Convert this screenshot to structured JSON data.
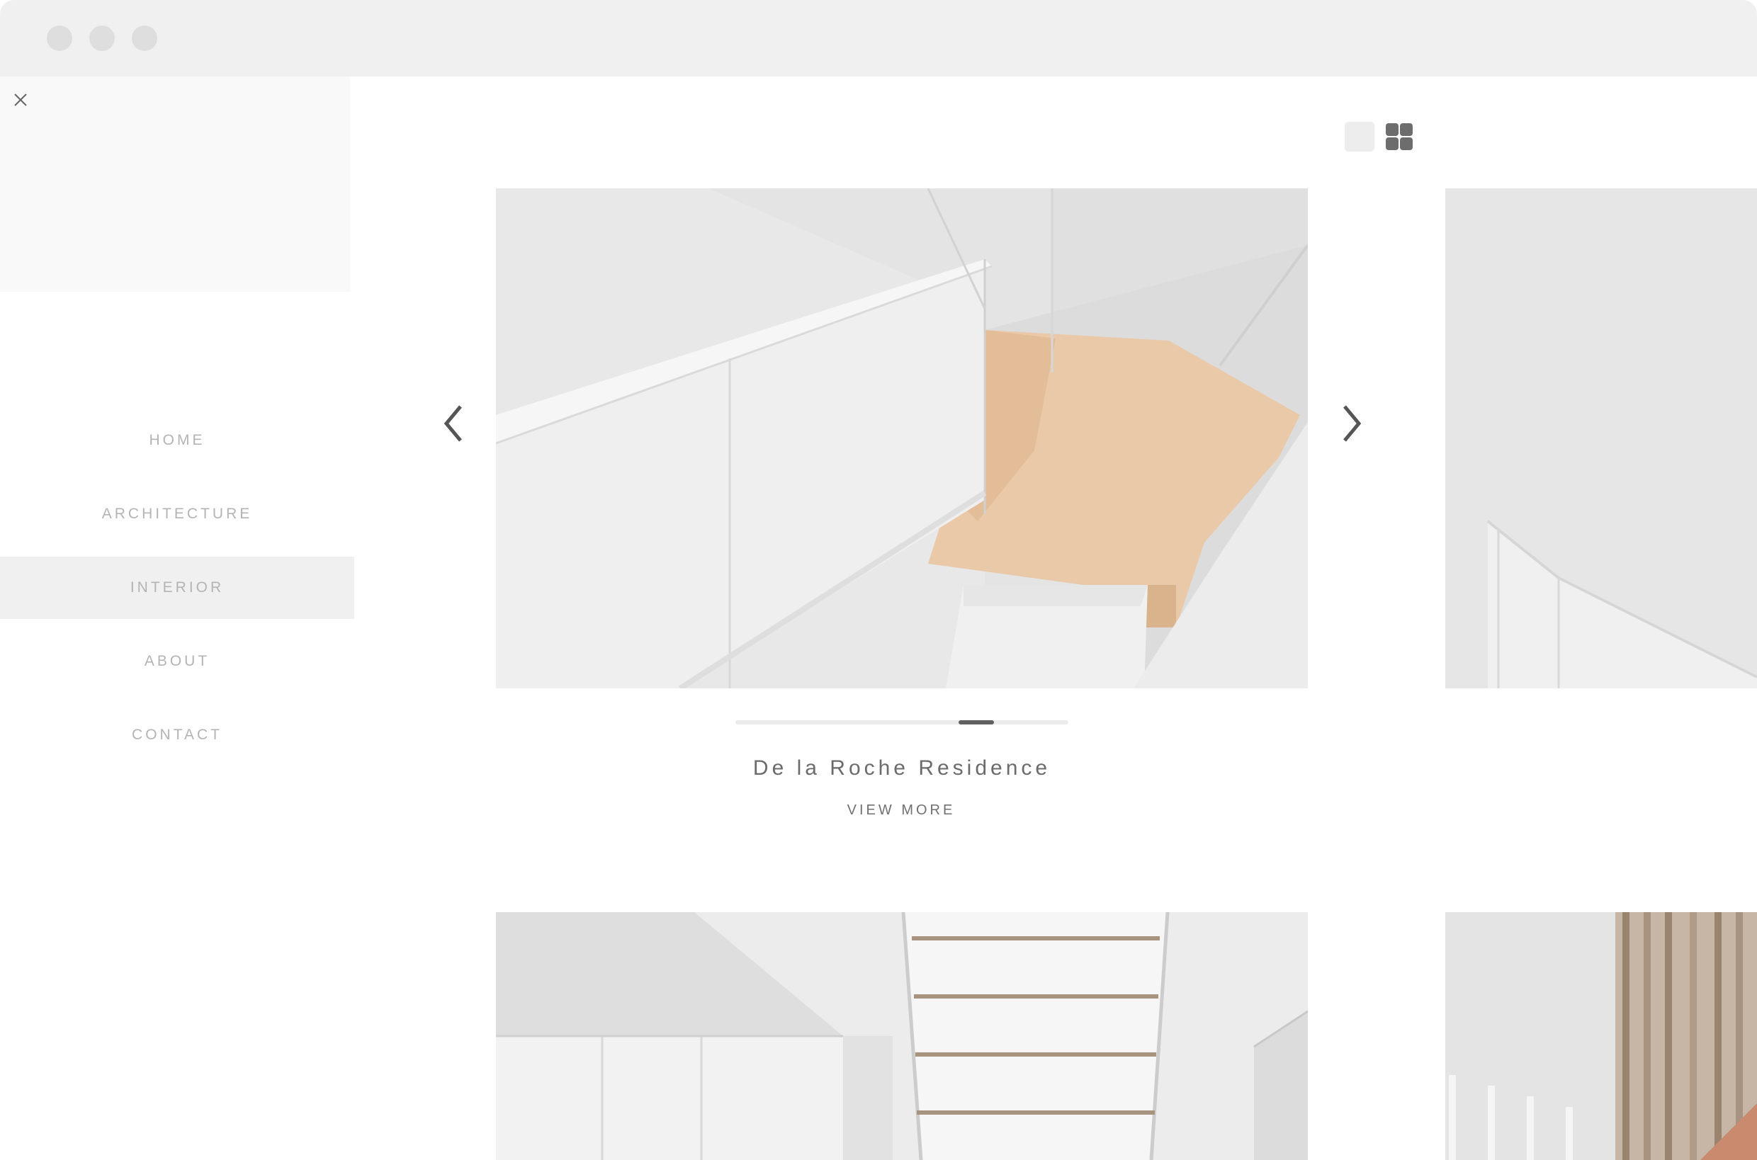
{
  "window": {
    "controls": [
      "close-dot",
      "minimize-dot",
      "maximize-dot"
    ]
  },
  "sidebar": {
    "close_icon": "close-icon",
    "items": [
      {
        "label": "HOME",
        "active": false
      },
      {
        "label": "ARCHITECTURE",
        "active": false
      },
      {
        "label": "INTERIOR",
        "active": true
      },
      {
        "label": "ABOUT",
        "active": false
      },
      {
        "label": "CONTACT",
        "active": false
      }
    ]
  },
  "toolbar": {
    "view_single_icon": "single-view-icon",
    "view_grid_icon": "grid-view-icon",
    "selected_view": "grid"
  },
  "featured": {
    "title": "De la Roche Residence",
    "view_more": "VIEW MORE",
    "prev_icon": "chevron-left-icon",
    "next_icon": "chevron-right-icon",
    "slider": {
      "position": 0.75
    }
  },
  "colors": {
    "accent": "#616161",
    "nav_text": "#b4b4b4",
    "active_bg": "#f0f0f0",
    "wood": "#e9c9a8"
  }
}
